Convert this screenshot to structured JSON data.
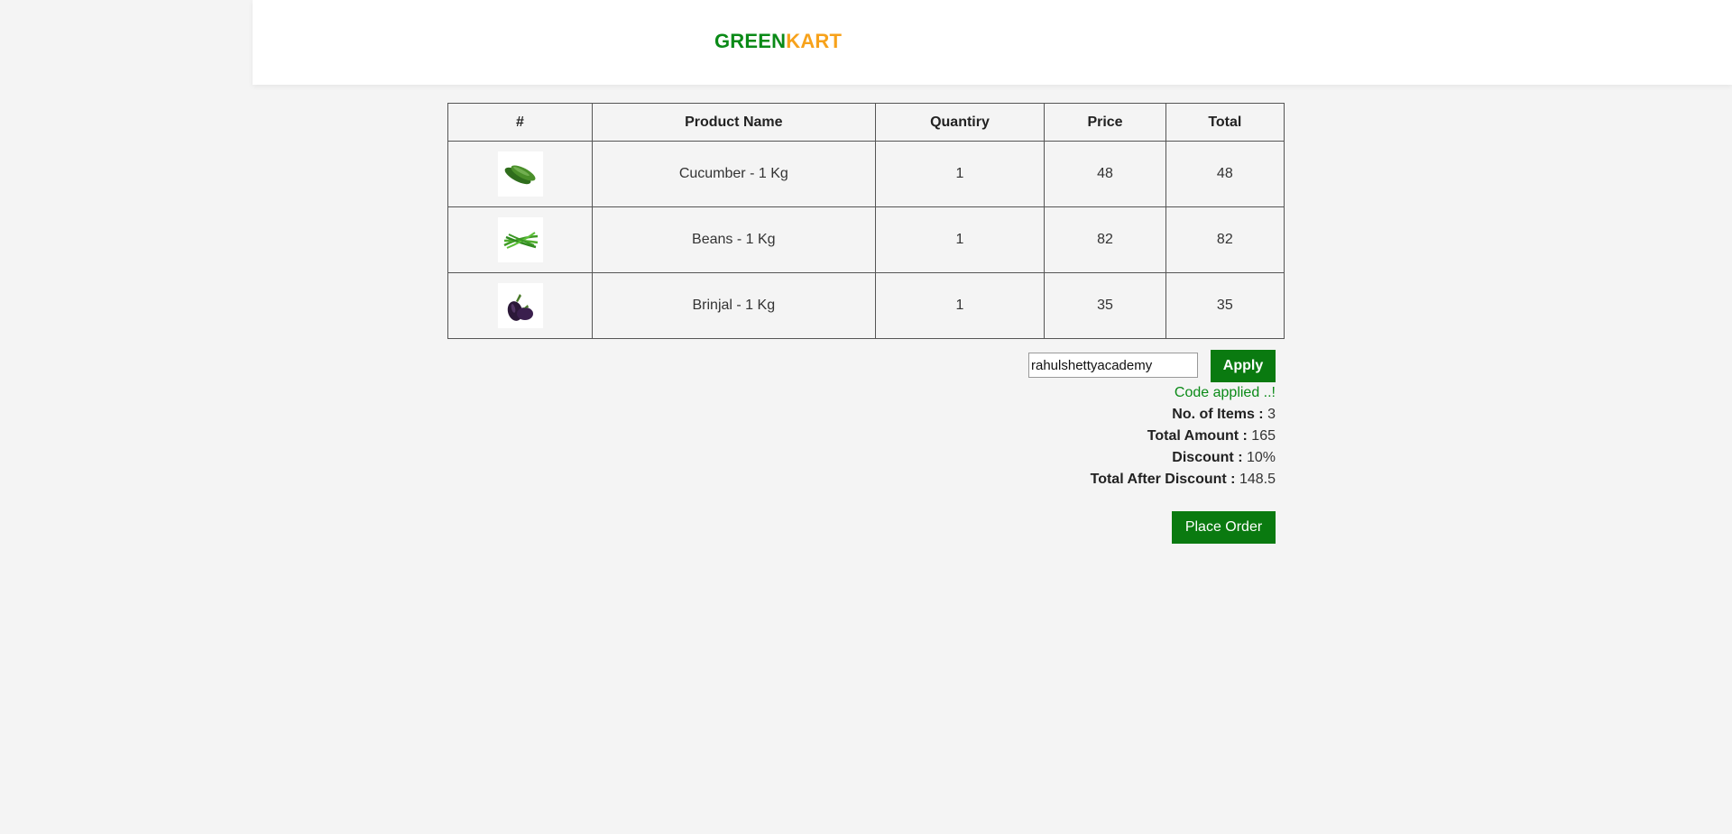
{
  "brand": {
    "part1": "GREEN",
    "part2": "KART"
  },
  "table": {
    "headers": [
      "#",
      "Product Name",
      "Quantiry",
      "Price",
      "Total"
    ],
    "rows": [
      {
        "icon": "cucumber-icon",
        "name": "Cucumber - 1 Kg",
        "quantity": "1",
        "price": "48",
        "total": "48"
      },
      {
        "icon": "beans-icon",
        "name": "Beans - 1 Kg",
        "quantity": "1",
        "price": "82",
        "total": "82"
      },
      {
        "icon": "brinjal-icon",
        "name": "Brinjal - 1 Kg",
        "quantity": "1",
        "price": "35",
        "total": "35"
      }
    ]
  },
  "promo": {
    "code_value": "rahulshettyacademy",
    "apply_label": "Apply",
    "status": "Code applied ..!"
  },
  "summary": {
    "items_label": "No. of Items :",
    "items_value": "3",
    "amount_label": "Total Amount :",
    "amount_value": "165",
    "discount_label": "Discount :",
    "discount_value": "10%",
    "after_label": "Total After Discount :",
    "after_value": "148.5"
  },
  "place_order_label": "Place Order",
  "colors": {
    "brand_green": "#0a8a17",
    "brand_orange": "#f7a21b",
    "button_green": "#0a7a10",
    "background": "#f4f4f4"
  }
}
